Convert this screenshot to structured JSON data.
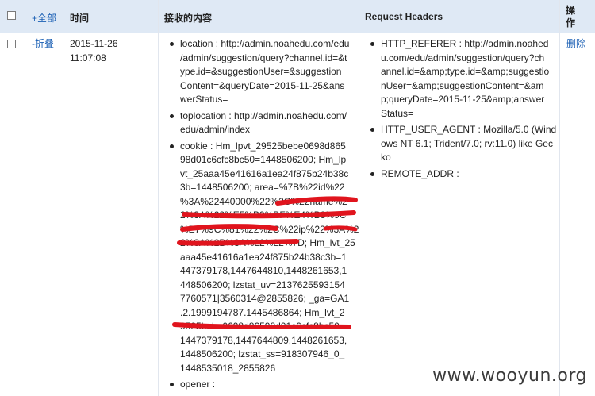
{
  "header": {
    "select_all": "+全部",
    "time": "时间",
    "content": "接收的内容",
    "request_headers": "Request Headers",
    "action": "操作"
  },
  "row": {
    "toggle": "-折叠",
    "date": "2015-11-26",
    "time": "11:07:08",
    "delete": "删除",
    "content_items": [
      {
        "lines": [
          "location : http://admin.noahedu.com/edu",
          "/admin/suggestion/query?channel.id=&t",
          "ype.id=&suggestionUser=&suggestion",
          "Content=&queryDate=2015-11-25&ans",
          "werStatus="
        ]
      },
      {
        "lines": [
          "toplocation : http://admin.noahedu.com/",
          "edu/admin/index"
        ]
      },
      {
        "lines": [
          "cookie : Hm_lpvt_29525bebe0698d865",
          "98d01c6cfc8bc50=1448506200; Hm_lp",
          "vt_25aaa45e41616a1ea24f875b24b38c",
          "3b=1448506200; area=%7B%22id%22",
          "%3A%22440000%22%2C%22name%2",
          "2%3A%22%E5%B9%BF%E4%B8%9C",
          "%E7%9C%81%22%2C%22ip%22%3A%2",
          "2%3A%2B%3A%22%22%7D; Hm_lvt_25",
          "aaa45e41616a1ea24f875b24b38c3b=1",
          "447379178,1447644810,1448261653,1",
          "448506200; lzstat_uv=2137625593154",
          "7760571|3560314@2855826; _ga=GA1",
          ".2.1999194787.1445486864; Hm_lvt_2",
          "9525bebe0698d86598d01c6cfc8bc50=",
          "1447379178,1447644809,1448261653,",
          "1448506200; lzstat_ss=918307946_0_",
          "1448535018_2855826"
        ]
      },
      {
        "lines": [
          "opener :"
        ]
      }
    ],
    "header_items": [
      {
        "lines": [
          "HTTP_REFERER : http://admin.noahed",
          "u.com/edu/admin/suggestion/query?ch",
          "annel.id=&amp;type.id=&amp;suggestio",
          "nUser=&amp;suggestionContent=&am",
          "p;queryDate=2015-11-25&amp;answer",
          "Status="
        ]
      },
      {
        "lines": [
          "HTTP_USER_AGENT : Mozilla/5.0 (Wind",
          "ows NT 6.1; Trident/7.0; rv:11.0) like Gec",
          "ko"
        ]
      },
      {
        "lines": [
          "REMOTE_ADDR :"
        ]
      }
    ]
  },
  "watermark": "www.wooyun.org",
  "colors": {
    "header_bg": "#dfe9f5",
    "link": "#1a5fb4",
    "redaction": "#e0141d"
  }
}
